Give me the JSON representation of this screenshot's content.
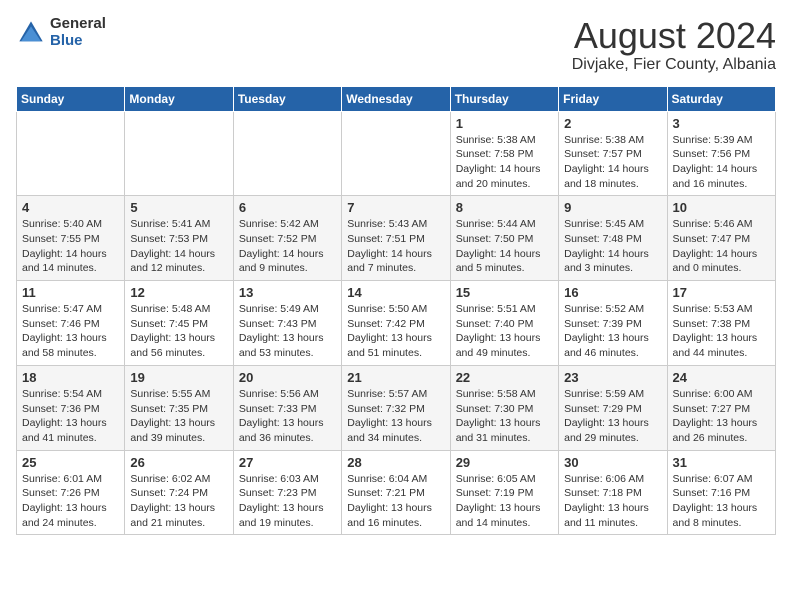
{
  "header": {
    "logo_general": "General",
    "logo_blue": "Blue",
    "month_title": "August 2024",
    "subtitle": "Divjake, Fier County, Albania"
  },
  "days_of_week": [
    "Sunday",
    "Monday",
    "Tuesday",
    "Wednesday",
    "Thursday",
    "Friday",
    "Saturday"
  ],
  "weeks": [
    [
      {
        "day": "",
        "info": ""
      },
      {
        "day": "",
        "info": ""
      },
      {
        "day": "",
        "info": ""
      },
      {
        "day": "",
        "info": ""
      },
      {
        "day": "1",
        "info": "Sunrise: 5:38 AM\nSunset: 7:58 PM\nDaylight: 14 hours\nand 20 minutes."
      },
      {
        "day": "2",
        "info": "Sunrise: 5:38 AM\nSunset: 7:57 PM\nDaylight: 14 hours\nand 18 minutes."
      },
      {
        "day": "3",
        "info": "Sunrise: 5:39 AM\nSunset: 7:56 PM\nDaylight: 14 hours\nand 16 minutes."
      }
    ],
    [
      {
        "day": "4",
        "info": "Sunrise: 5:40 AM\nSunset: 7:55 PM\nDaylight: 14 hours\nand 14 minutes."
      },
      {
        "day": "5",
        "info": "Sunrise: 5:41 AM\nSunset: 7:53 PM\nDaylight: 14 hours\nand 12 minutes."
      },
      {
        "day": "6",
        "info": "Sunrise: 5:42 AM\nSunset: 7:52 PM\nDaylight: 14 hours\nand 9 minutes."
      },
      {
        "day": "7",
        "info": "Sunrise: 5:43 AM\nSunset: 7:51 PM\nDaylight: 14 hours\nand 7 minutes."
      },
      {
        "day": "8",
        "info": "Sunrise: 5:44 AM\nSunset: 7:50 PM\nDaylight: 14 hours\nand 5 minutes."
      },
      {
        "day": "9",
        "info": "Sunrise: 5:45 AM\nSunset: 7:48 PM\nDaylight: 14 hours\nand 3 minutes."
      },
      {
        "day": "10",
        "info": "Sunrise: 5:46 AM\nSunset: 7:47 PM\nDaylight: 14 hours\nand 0 minutes."
      }
    ],
    [
      {
        "day": "11",
        "info": "Sunrise: 5:47 AM\nSunset: 7:46 PM\nDaylight: 13 hours\nand 58 minutes."
      },
      {
        "day": "12",
        "info": "Sunrise: 5:48 AM\nSunset: 7:45 PM\nDaylight: 13 hours\nand 56 minutes."
      },
      {
        "day": "13",
        "info": "Sunrise: 5:49 AM\nSunset: 7:43 PM\nDaylight: 13 hours\nand 53 minutes."
      },
      {
        "day": "14",
        "info": "Sunrise: 5:50 AM\nSunset: 7:42 PM\nDaylight: 13 hours\nand 51 minutes."
      },
      {
        "day": "15",
        "info": "Sunrise: 5:51 AM\nSunset: 7:40 PM\nDaylight: 13 hours\nand 49 minutes."
      },
      {
        "day": "16",
        "info": "Sunrise: 5:52 AM\nSunset: 7:39 PM\nDaylight: 13 hours\nand 46 minutes."
      },
      {
        "day": "17",
        "info": "Sunrise: 5:53 AM\nSunset: 7:38 PM\nDaylight: 13 hours\nand 44 minutes."
      }
    ],
    [
      {
        "day": "18",
        "info": "Sunrise: 5:54 AM\nSunset: 7:36 PM\nDaylight: 13 hours\nand 41 minutes."
      },
      {
        "day": "19",
        "info": "Sunrise: 5:55 AM\nSunset: 7:35 PM\nDaylight: 13 hours\nand 39 minutes."
      },
      {
        "day": "20",
        "info": "Sunrise: 5:56 AM\nSunset: 7:33 PM\nDaylight: 13 hours\nand 36 minutes."
      },
      {
        "day": "21",
        "info": "Sunrise: 5:57 AM\nSunset: 7:32 PM\nDaylight: 13 hours\nand 34 minutes."
      },
      {
        "day": "22",
        "info": "Sunrise: 5:58 AM\nSunset: 7:30 PM\nDaylight: 13 hours\nand 31 minutes."
      },
      {
        "day": "23",
        "info": "Sunrise: 5:59 AM\nSunset: 7:29 PM\nDaylight: 13 hours\nand 29 minutes."
      },
      {
        "day": "24",
        "info": "Sunrise: 6:00 AM\nSunset: 7:27 PM\nDaylight: 13 hours\nand 26 minutes."
      }
    ],
    [
      {
        "day": "25",
        "info": "Sunrise: 6:01 AM\nSunset: 7:26 PM\nDaylight: 13 hours\nand 24 minutes."
      },
      {
        "day": "26",
        "info": "Sunrise: 6:02 AM\nSunset: 7:24 PM\nDaylight: 13 hours\nand 21 minutes."
      },
      {
        "day": "27",
        "info": "Sunrise: 6:03 AM\nSunset: 7:23 PM\nDaylight: 13 hours\nand 19 minutes."
      },
      {
        "day": "28",
        "info": "Sunrise: 6:04 AM\nSunset: 7:21 PM\nDaylight: 13 hours\nand 16 minutes."
      },
      {
        "day": "29",
        "info": "Sunrise: 6:05 AM\nSunset: 7:19 PM\nDaylight: 13 hours\nand 14 minutes."
      },
      {
        "day": "30",
        "info": "Sunrise: 6:06 AM\nSunset: 7:18 PM\nDaylight: 13 hours\nand 11 minutes."
      },
      {
        "day": "31",
        "info": "Sunrise: 6:07 AM\nSunset: 7:16 PM\nDaylight: 13 hours\nand 8 minutes."
      }
    ]
  ]
}
